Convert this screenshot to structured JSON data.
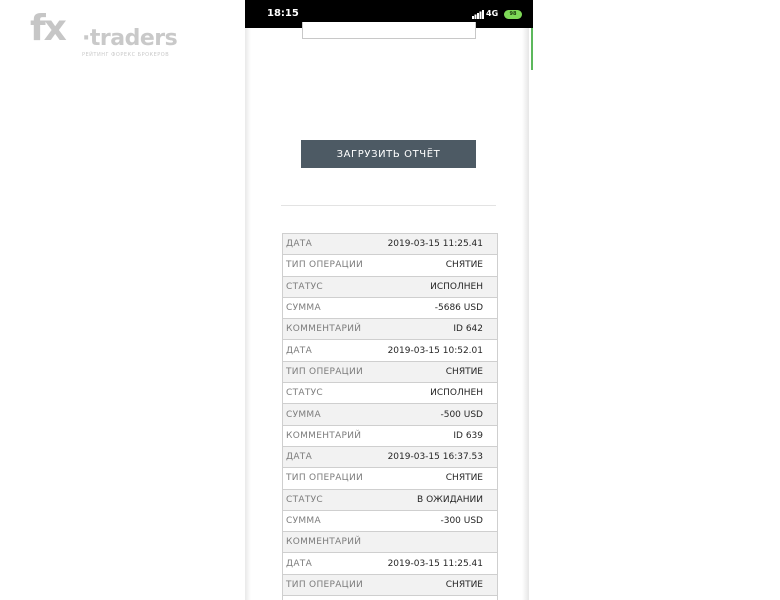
{
  "watermark": {
    "brand_fx": "fx",
    "brand_traders": "·traders",
    "tagline": "РЕЙТИНГ ФОРЕКС БРОКЕРОВ"
  },
  "status_bar": {
    "time": "18:15",
    "network": "4G",
    "battery": "98"
  },
  "actions": {
    "upload_label": "ЗАГРУЗИТЬ ОТЧЁТ"
  },
  "colors": {
    "button_bg": "#4d5a64",
    "accent_green": "#5cb85c",
    "row_shade": "#f2f2f2"
  },
  "transactions": [
    {
      "key": "ДАТА",
      "value": "2019-03-15 11:25.41"
    },
    {
      "key": "ТИП ОПЕРАЦИИ",
      "value": "СНЯТИЕ"
    },
    {
      "key": "СТАТУС",
      "value": "ИСПОЛНЕН"
    },
    {
      "key": "СУММА",
      "value": "-5686 USD"
    },
    {
      "key": "КОММЕНТАРИЙ",
      "value": "ID 642"
    },
    {
      "key": "ДАТА",
      "value": "2019-03-15 10:52.01"
    },
    {
      "key": "ТИП ОПЕРАЦИИ",
      "value": "СНЯТИЕ"
    },
    {
      "key": "СТАТУС",
      "value": "ИСПОЛНЕН"
    },
    {
      "key": "СУММА",
      "value": "-500 USD"
    },
    {
      "key": "КОММЕНТАРИЙ",
      "value": "ID 639"
    },
    {
      "key": "ДАТА",
      "value": "2019-03-15 16:37.53"
    },
    {
      "key": "ТИП ОПЕРАЦИИ",
      "value": "СНЯТИЕ"
    },
    {
      "key": "СТАТУС",
      "value": "В ОЖИДАНИИ"
    },
    {
      "key": "СУММА",
      "value": "-300 USD"
    },
    {
      "key": "КОММЕНТАРИЙ",
      "value": ""
    },
    {
      "key": "ДАТА",
      "value": "2019-03-15 11:25.41"
    },
    {
      "key": "ТИП ОПЕРАЦИИ",
      "value": "СНЯТИЕ"
    },
    {
      "key": "",
      "value": ""
    }
  ]
}
